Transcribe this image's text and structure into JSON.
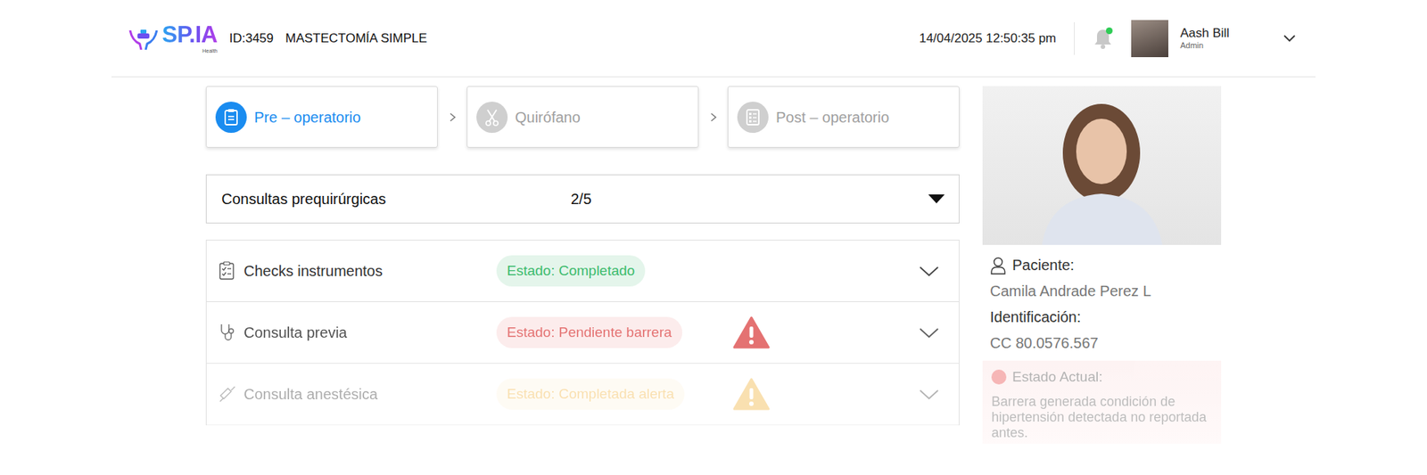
{
  "header": {
    "logo": "SP.IA",
    "logo_sub": "Health",
    "case_id": "ID:3459",
    "procedure": "MASTECTOMÍA SIMPLE",
    "datetime": "14/04/2025 12:50:35 pm",
    "notifications": {
      "unread": true
    },
    "user": {
      "name": "Aash Bill",
      "role": "Admin"
    }
  },
  "steps": [
    {
      "label": "Pre – operatorio",
      "selected": true
    },
    {
      "label": "Quirófano",
      "selected": false
    },
    {
      "label": "Post – operatorio",
      "selected": false
    }
  ],
  "consultations": {
    "title": "Consultas prequirúrgicas",
    "count": "2/5",
    "expanded": false
  },
  "checks": [
    {
      "label": "Checks instrumentos",
      "status": "Estado: Completado",
      "color": "#3dbb6e",
      "warning": false,
      "expanded": false,
      "kind": "checklist"
    },
    {
      "label": "Consulta previa",
      "status": "Estado: Pendiente barrera",
      "color": "#e05a5a",
      "warning": true,
      "expanded": false,
      "kind": "consult"
    },
    {
      "label": "Consulta anestésica",
      "status": "Estado: Completada alerta",
      "color": "#f2b33d",
      "warning": true,
      "expanded": false,
      "kind": "anesthesia"
    }
  ],
  "patient": {
    "label": "Paciente:",
    "name": "Camila Andrade Perez L",
    "id_label": "Identificación:",
    "id": "CC 80.0576.567"
  },
  "current_status": {
    "title": "Estado Actual:",
    "text": "Barrera generada condición de hipertensión detectada no reportada antes."
  }
}
